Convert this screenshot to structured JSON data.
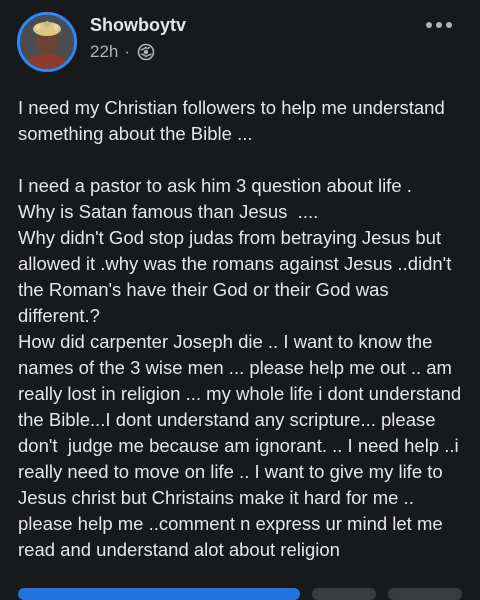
{
  "post": {
    "author": "Showboytv",
    "time": "22h",
    "separator": "·",
    "privacy_icon": "globe-icon",
    "more_icon": "more-horizontal-icon",
    "paragraphs": [
      "I need my Christian followers to help me understand something about the Bible ...",
      "I need a pastor to ask him 3 question about life .\nWhy is Satan famous than Jesus  ....\nWhy didn't God stop judas from betraying Jesus but allowed it .why was the romans against Jesus ..didn't the Roman's have their God or their God was different.?\nHow did carpenter Joseph die .. I want to know the names of the 3 wise men ... please help me out .. am  really lost in religion ... my whole life i dont understand the Bible...I dont understand any scripture... please don't  judge me because am ignorant. .. I need help ..i really need to move on life .. I want to give my life to Jesus christ but Christains make it hard for me .. please help me ..comment n express ur mind let me read and understand alot about religion"
    ]
  },
  "colors": {
    "background": "#18191a",
    "primary_text": "#e4e6eb",
    "secondary_text": "#b0b3b8",
    "avatar_ring": "#2d88ff",
    "primary_button": "#2374e1",
    "secondary_button": "#3a3b3c"
  }
}
